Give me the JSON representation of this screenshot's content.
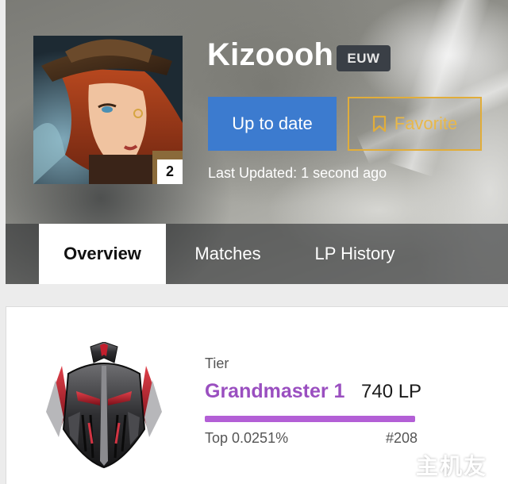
{
  "profile": {
    "summoner_name": "Kizoooh",
    "region": "EUW",
    "level": "2",
    "avatar_icon": "champion-portrait-icon"
  },
  "actions": {
    "update_label": "Up to date",
    "favorite_label": "Favorite",
    "favorite_icon": "bookmark-icon",
    "last_updated": "Last Updated: 1 second ago"
  },
  "tabs": [
    {
      "label": "Overview",
      "active": true
    },
    {
      "label": "Matches",
      "active": false
    },
    {
      "label": "LP History",
      "active": false
    }
  ],
  "rank": {
    "tier_label": "Tier",
    "tier_name": "Grandmaster 1",
    "lp": "740 LP",
    "progress_fraction": 1.0,
    "top_percent": "Top 0.0251%",
    "ladder_rank": "#208",
    "emblem_icon": "grandmaster-emblem-icon"
  },
  "colors": {
    "accent_blue": "#3c7bcf",
    "favorite_gold": "#e1ad3a",
    "grandmaster_purple": "#9a4fc0",
    "progress_fill": "#b35fd6"
  },
  "watermark": {
    "text": "主机友",
    "icon": "gamepad-icon"
  }
}
